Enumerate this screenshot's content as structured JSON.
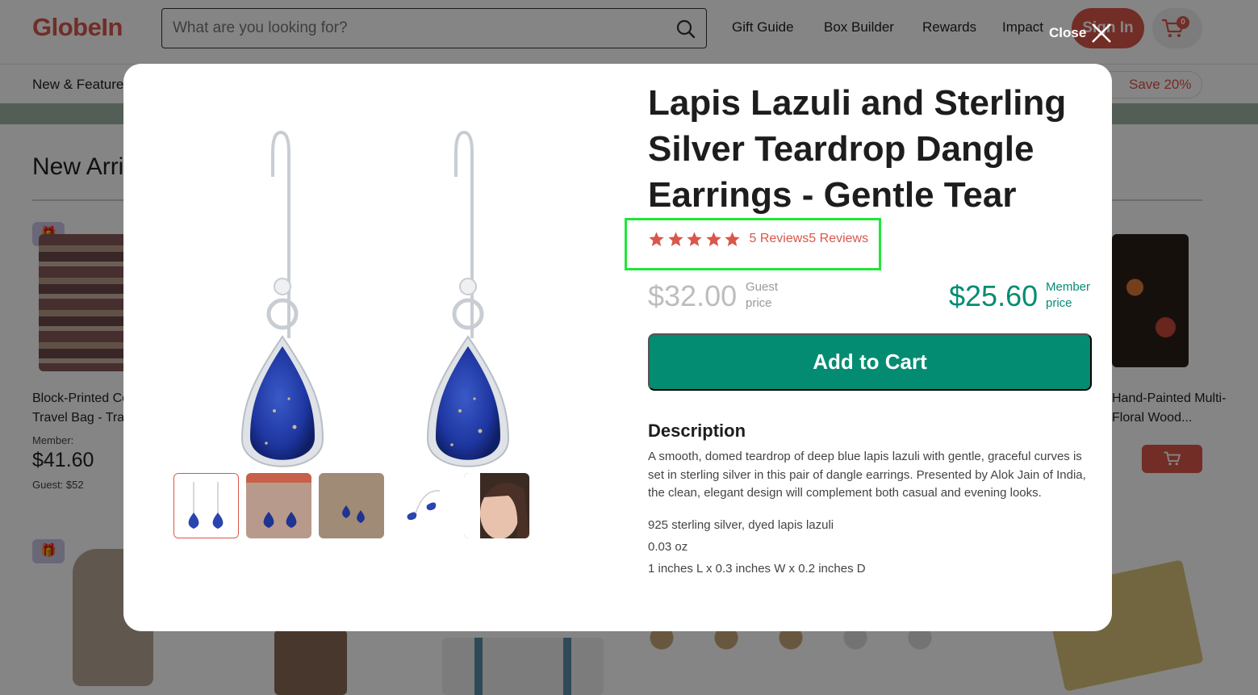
{
  "header": {
    "logo": "GlobeIn",
    "search_placeholder": "What are you looking for?",
    "nav": [
      "Gift Guide",
      "Box Builder",
      "Rewards",
      "Impact"
    ],
    "sign_in": "Sign In",
    "cart_count": "0"
  },
  "subnav": {
    "first_item": "New & Featured",
    "save_pill": "Save 20%"
  },
  "section": {
    "title": "New Arrivals"
  },
  "background_products": [
    {
      "name_line1": "Block-Printed Cotton",
      "name_line2": "Travel Bag - Travel",
      "member_label": "Member:",
      "member_price": "$41.60",
      "guest_label": "Guest: $52"
    },
    {
      "name_line1": "Hand-Painted Multi-",
      "name_line2": "Floral Wood..."
    }
  ],
  "overlay": {
    "close_label": "Close"
  },
  "modal": {
    "title": "Lapis Lazuli and Sterling Silver Teardrop Dangle Earrings - Gentle Tear",
    "rating_stars": 5,
    "reviews_text": "5 Reviews5 Reviews",
    "guest_price": "$32.00",
    "guest_note": "Guest price",
    "member_price": "$25.60",
    "member_note": "Member price",
    "add_to_cart": "Add to Cart",
    "description_heading": "Description",
    "description": "A smooth, domed teardrop of deep blue lapis lazuli with gentle, graceful curves is set in sterling silver in this pair of dangle earrings. Presented by Alok Jain of India, the clean, elegant design will complement both casual and evening looks.",
    "specs": [
      "925 sterling silver, dyed lapis lazuli",
      "0.03 oz",
      "1 inches L x 0.3 inches W x 0.2 inches D"
    ],
    "thumbnail_count": 5
  },
  "colors": {
    "brand": "#d9574a",
    "member_green": "#048c73",
    "highlight": "#22e53a"
  }
}
